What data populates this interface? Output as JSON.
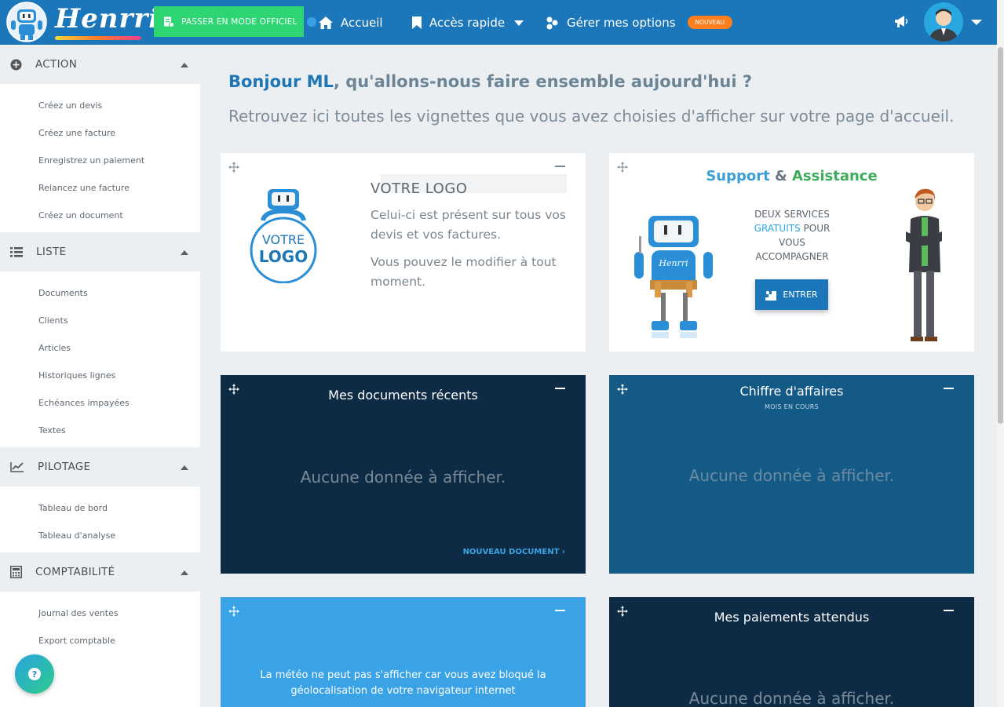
{
  "topbar": {
    "brand": "Henrri",
    "official_button": "PASSER EN MODE OFFICIEL",
    "nav": {
      "home": "Accueil",
      "quick_access": "Accès rapide",
      "options": "Gérer mes options",
      "new_badge": "NOUVEAU"
    }
  },
  "sidebar": {
    "sections": [
      {
        "label": "ACTION",
        "items": [
          "Créez un devis",
          "Créez une facture",
          "Enregistrez un paiement",
          "Relancez une facture",
          "Créez un document"
        ]
      },
      {
        "label": "LISTE",
        "items": [
          "Documents",
          "Clients",
          "Articles",
          "Historiques lignes",
          "Echéances impayées",
          "Textes"
        ]
      },
      {
        "label": "PILOTAGE",
        "items": [
          "Tableau de bord",
          "Tableau d'analyse"
        ]
      },
      {
        "label": "COMPTABILITÉ",
        "items": [
          "Journal des ventes",
          "Export comptable"
        ]
      }
    ]
  },
  "main": {
    "greeting_name": "Bonjour ML",
    "greeting_rest": ", qu'allons-nous faire ensemble aujourd'hui ?",
    "subtitle": "Retrouvez ici toutes les vignettes que vous avez choisies d'afficher sur votre page d'accueil.",
    "logo_card": {
      "badge_line1": "VOTRE",
      "badge_line2": "LOGO",
      "title": "VOTRE LOGO",
      "text1": "Celui-ci est présent sur tous vos devis et vos factures.",
      "text2": "Vous pouvez le modifier à tout moment."
    },
    "support_card": {
      "title_part1": "Support",
      "title_amp": " & ",
      "title_part2": "Assistance",
      "desc_line1": "DEUX SERVICES",
      "desc_highlight": "GRATUITS",
      "desc_rest": " POUR VOUS ACCOMPAGNER",
      "enter_label": "ENTRER"
    },
    "recent_docs": {
      "title": "Mes documents récents",
      "empty": "Aucune donnée à afficher.",
      "new_doc": "NOUVEAU DOCUMENT"
    },
    "revenue": {
      "title": "Chiffre d'affaires",
      "subtitle": "MOIS EN COURS",
      "empty": "Aucune donnée à afficher."
    },
    "weather": {
      "message": "La météo ne peut pas s'afficher car vous avez bloqué la géolocalisation de votre navigateur internet"
    },
    "payments": {
      "title": "Mes paiements attendus",
      "empty": "Aucune donnée à afficher."
    }
  },
  "colors": {
    "topbar": "#1b77b9",
    "official": "#2ed673",
    "badge": "#ff7f1f",
    "dark_card": "#0d2b45",
    "blue_card": "#135a86",
    "sky_card": "#3aa3e5"
  }
}
